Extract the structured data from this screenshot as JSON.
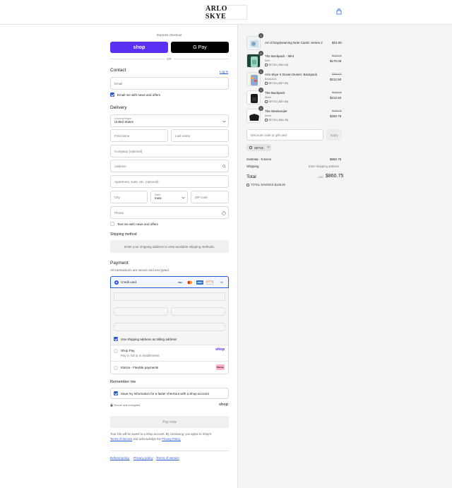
{
  "header": {
    "logo_text": "ARLO SKYE",
    "cart_icon": "shopping-bag-icon"
  },
  "express": {
    "title": "Express checkout",
    "shop_label": "shop",
    "gpay_label": "G Pay",
    "or_label": "OR"
  },
  "contact": {
    "title": "Contact",
    "login_label": "Log in",
    "email_placeholder": "Email",
    "news_label": "Email me with news and offers"
  },
  "delivery": {
    "title": "Delivery",
    "country_label": "Country/Region",
    "country_value": "United States",
    "first_name": "First name",
    "last_name": "Last name",
    "company": "Company (optional)",
    "address": "Address",
    "apartment": "Apartment, suite, etc. (optional)",
    "city": "City",
    "state_label": "State",
    "state_value": "Iowa",
    "zip": "ZIP code",
    "phone": "Phone",
    "sms_label": "Text me with news and offers"
  },
  "shipping": {
    "title": "Shipping method",
    "info": "Enter your shipping address to view available shipping methods."
  },
  "payment": {
    "title": "Payment",
    "subtitle": "All transactions are secure and encrypted.",
    "credit_card": "Credit card",
    "more_cards": "+4",
    "cards": [
      "VISA",
      "MC",
      "AMEX",
      "DISCOVER"
    ],
    "billing_label": "Use shipping address as billing address",
    "shop_pay_title": "Shop Pay",
    "shop_pay_sub": "Pay in full or in installments",
    "shop_pay_logo": "shop",
    "klarna": "Klarna - Flexible payments",
    "klarna_logo": "Klarna."
  },
  "remember": {
    "title": "Remember me",
    "save_label": "Save my information for a faster checkout with a Shop account",
    "secure": "Secure and encrypted",
    "shop_logo": "shop"
  },
  "pay_now": "Pay now",
  "legal": {
    "line1": "Your info will be saved to a Shop account. By continuing, you agree to Shop's",
    "terms": "Terms of Service",
    "and": "and acknowledge the",
    "privacy": "Privacy Policy."
  },
  "footer": {
    "refund": "Refund policy",
    "privacy": "Privacy policy",
    "terms": "Terms of service"
  },
  "cart": {
    "items": [
      {
        "qty": "1",
        "name": "Art of Daydreaming Note Cards: Series 2",
        "variant": "",
        "discount": "",
        "orig": "",
        "price": "$15.00"
      },
      {
        "qty": "1",
        "name": "The Backpack - Mint",
        "variant": "Mint",
        "discount": "SET15 (-$30.00)",
        "orig": "$200.00",
        "price": "$170.00"
      },
      {
        "qty": "1",
        "name": "Arlo Skye X Dusen Dusen: Backpack",
        "variant": "Backpack",
        "discount": "SET15 (-$37.50)",
        "orig": "$250.00",
        "price": "$212.50"
      },
      {
        "qty": "1",
        "name": "The Backpack",
        "variant": "Black",
        "discount": "SET15 (-$37.50)",
        "orig": "$250.00",
        "price": "$212.50"
      },
      {
        "qty": "1",
        "name": "The Weekender",
        "variant": "Black",
        "discount": "SET15 (-$44.25)",
        "orig": "$295.00",
        "price": "$250.75"
      }
    ],
    "discount_placeholder": "Discount code or gift card",
    "apply_label": "Apply",
    "code_tag": "SET15",
    "subtotal_label": "Subtotal · 5 items",
    "subtotal_value": "$860.75",
    "shipping_label": "Shipping",
    "shipping_value": "Enter shipping address",
    "total_label": "Total",
    "currency": "USD",
    "total_value": "$860.75",
    "savings_label": "TOTAL SAVINGS",
    "savings_value": "$149.25"
  }
}
